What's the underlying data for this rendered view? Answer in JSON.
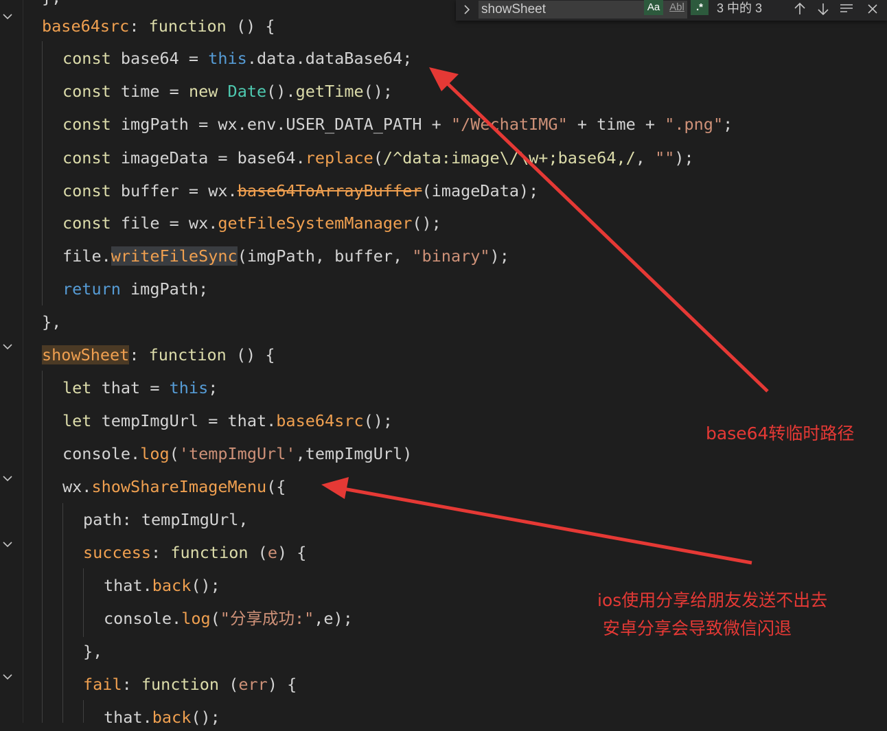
{
  "find": {
    "query": "showSheet",
    "match_case_label": "Aa",
    "whole_word_label": "Abl",
    "regex_label": ".*",
    "count": "3 中的 3"
  },
  "code": {
    "l1": {
      "name": "base64src",
      "colon": ": ",
      "kw": "function",
      "rest": " () {"
    },
    "l2": {
      "kw": "const",
      "a": " base64 = ",
      "this": "this",
      "b": ".data.dataBase64;"
    },
    "l3": {
      "kw": "const",
      "a": " time = ",
      "new": "new",
      "sp": " ",
      "cls": "Date",
      "b": "().",
      "fn": "getTime",
      "c": "();"
    },
    "l4": {
      "kw": "const",
      "a": " imgPath = wx.env.USER_DATA_PATH + ",
      "s1": "\"/WechatIMG\"",
      "b": " + time + ",
      "s2": "\".png\"",
      "c": ";"
    },
    "l5": {
      "kw": "const",
      "a": " imageData = base64.",
      "fn": "replace",
      "b": "(",
      "re": "/^data:image\\/\\w+;base64,/",
      "c": ", ",
      "s": "\"\"",
      "d": ");"
    },
    "l6": {
      "kw": "const",
      "a": " buffer = wx.",
      "fn": "base64ToArrayBuffer",
      "b": "(imageData);"
    },
    "l7": {
      "kw": "const",
      "a": " file = wx.",
      "fn": "getFileSystemManager",
      "b": "();"
    },
    "l8": {
      "a": "file.",
      "fn": "writeFileSync",
      "b": "(imgPath, buffer, ",
      "s": "\"binary\"",
      "c": ");"
    },
    "l9": {
      "kw": "return",
      "a": " imgPath;"
    },
    "l10": {
      "a": "},"
    },
    "l11": {
      "name": "showSheet",
      "colon": ": ",
      "kw": "function",
      "rest": " () {"
    },
    "l12": {
      "kw": "let",
      "a": " that = ",
      "this": "this",
      "b": ";"
    },
    "l13": {
      "kw": "let",
      "a": " tempImgUrl = that.",
      "fn": "base64src",
      "b": "();"
    },
    "l14": {
      "a": "console.",
      "fn": "log",
      "b": "(",
      "s": "'tempImgUrl'",
      "c": ",tempImgUrl)"
    },
    "l15": {
      "a": "wx.",
      "fn": "showShareImageMenu",
      "b": "({"
    },
    "l16": {
      "a": "path: tempImgUrl,"
    },
    "l17": {
      "name": "success",
      "colon": ": ",
      "kw": "function",
      "b": " (",
      "p": "e",
      "c": ") {"
    },
    "l18": {
      "a": "that.",
      "fn": "back",
      "b": "();"
    },
    "l19": {
      "a": "console.",
      "fn": "log",
      "b": "(",
      "s": "\"分享成功:\"",
      "c": ",e);"
    },
    "l20": {
      "a": "},"
    },
    "l21": {
      "name": "fail",
      "colon": ": ",
      "kw": "function",
      "b": " (",
      "p": "err",
      "c": ") {"
    },
    "l22": {
      "a": "that.",
      "fn": "back",
      "b": "();"
    }
  },
  "annotations": {
    "a1": "base64转临时路径",
    "a2_line1": "ios使用分享给朋友发送不出去",
    "a2_line2": " 安卓分享会导致微信闪退"
  },
  "colors": {
    "annotation": "#e53935",
    "background": "#1e1e1e"
  }
}
